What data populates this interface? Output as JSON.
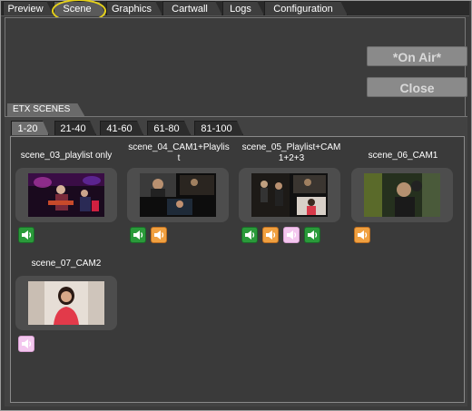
{
  "tabs": {
    "top": [
      {
        "label": "Preview",
        "active": false
      },
      {
        "label": "Scene",
        "active": true
      },
      {
        "label": "Graphics",
        "active": false
      },
      {
        "label": "Cartwall",
        "active": false
      },
      {
        "label": "Logs",
        "active": false
      },
      {
        "label": "Configuration",
        "active": false
      }
    ]
  },
  "buttons": {
    "on_air": "*On Air*",
    "close": "Close"
  },
  "etx": {
    "group_label": "ETX SCENES",
    "range_tabs": [
      "1-20",
      "21-40",
      "41-60",
      "61-80",
      "81-100"
    ],
    "active_range": "1-20"
  },
  "scenes": [
    {
      "name": "scene_03_playlist only",
      "icons": [
        "speaker-green"
      ]
    },
    {
      "name": "scene_04_CAM1+Playlist",
      "name_line1": "scene_04_CAM1+Playlis",
      "name_line2": "t",
      "icons": [
        "speaker-green",
        "speaker-orange"
      ]
    },
    {
      "name": "scene_05_Playlist+CAM1+2+3",
      "name_line1": "scene_05_Playlist+CAM",
      "name_line2": "1+2+3",
      "icons": [
        "speaker-green",
        "speaker-orange",
        "speaker-pink",
        "speaker-green"
      ]
    },
    {
      "name": "scene_06_CAM1",
      "icons": [
        "speaker-orange"
      ]
    },
    {
      "name": "scene_07_CAM2",
      "icons": [
        "speaker-pink"
      ]
    }
  ],
  "colors": {
    "highlight_circle": "#e6d21a",
    "audio_green": "#2a9a3a",
    "audio_orange": "#f0a040",
    "audio_pink": "#f3c7ee"
  }
}
